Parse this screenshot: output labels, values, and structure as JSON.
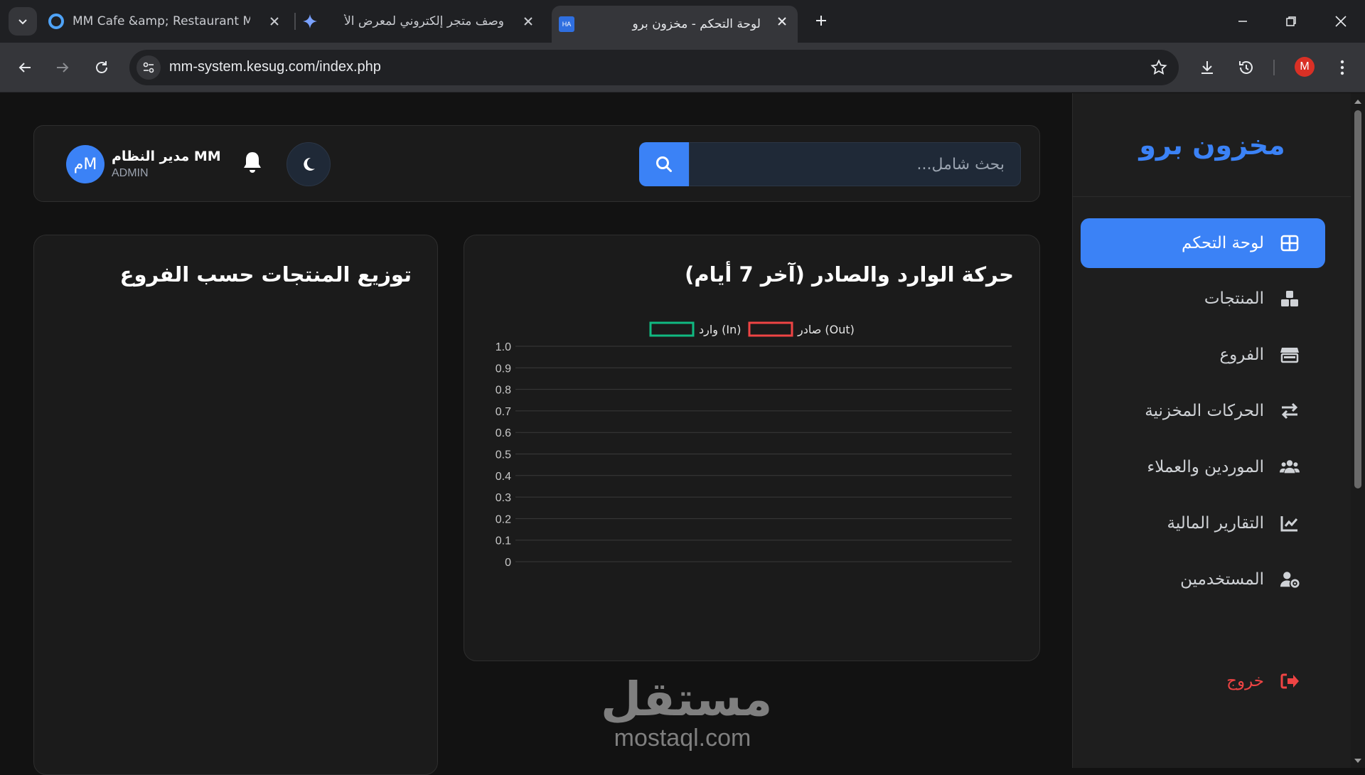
{
  "browser": {
    "tabs": [
      {
        "title": "MM Cafe &amp; Restaurant Ma",
        "favicon": "circle-logo-icon"
      },
      {
        "title": "وصف متجر إلكتروني لمعرض الأ",
        "favicon": "gemini-icon"
      },
      {
        "title": "لوحة التحكم - مخزون برو",
        "favicon": "ha-icon",
        "favicon_text": "HA",
        "active": true
      }
    ],
    "url": "mm-system.kesug.com/index.php",
    "profile_initial": "M"
  },
  "sidebar": {
    "brand": "مخزون برو",
    "items": [
      {
        "label": "لوحة التحكم",
        "icon": "dashboard-grid-icon",
        "active": true
      },
      {
        "label": "المنتجات",
        "icon": "boxes-icon"
      },
      {
        "label": "الفروع",
        "icon": "store-icon"
      },
      {
        "label": "الحركات المخزنية",
        "icon": "exchange-arrows-icon"
      },
      {
        "label": "الموردين والعملاء",
        "icon": "users-icon"
      },
      {
        "label": "التقارير المالية",
        "icon": "line-chart-icon"
      },
      {
        "label": "المستخدمين",
        "icon": "users-gear-icon"
      }
    ],
    "logout": {
      "label": "خروج",
      "icon": "sign-out-icon"
    }
  },
  "header": {
    "search_placeholder": "بحث شامل...",
    "user_name": "مدير النظام MM",
    "user_role": "ADMIN",
    "avatar_text": "مM"
  },
  "movement_card": {
    "title": "حركة الوارد والصادر (آخر 7 أيام)"
  },
  "branches_card": {
    "title": "توزيع المنتجات حسب الفروع"
  },
  "watermark": {
    "ar": "مستقل",
    "en": "mostaql.com"
  },
  "colors": {
    "accent": "#3b82f6",
    "in_series": "#10b981",
    "out_series": "#ef4444",
    "logout": "#ef4444"
  },
  "chart_data": {
    "type": "line",
    "series": [
      {
        "name": "وارد (In)",
        "values": []
      },
      {
        "name": "صادر (Out)",
        "values": []
      }
    ],
    "y_ticks": [
      "1.0",
      "0.9",
      "0.8",
      "0.7",
      "0.6",
      "0.5",
      "0.4",
      "0.3",
      "0.2",
      "0.1",
      "0"
    ],
    "ylim": [
      0,
      1
    ],
    "grid": true,
    "legend": "top-center"
  }
}
